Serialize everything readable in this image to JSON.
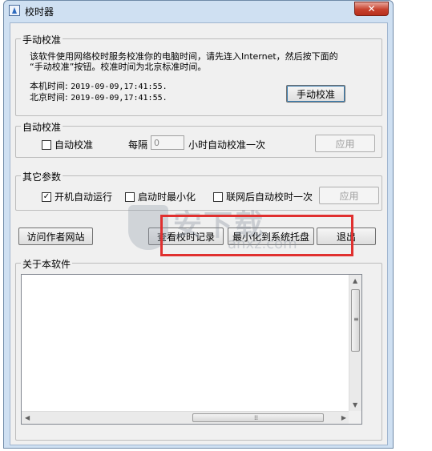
{
  "window": {
    "title": "校时器",
    "close_label": "✕"
  },
  "manual": {
    "legend": "手动校准",
    "description_line1": "该软件使用网络校时服务校准你的电脑时间，请先连入Internet，然后按下面的",
    "description_line2": "“手动校准”按钮。校准时间为北京标准时间。",
    "local_label": "本机时间:",
    "local_value": "2019-09-09,17:41:55.",
    "beijing_label": "北京时间:",
    "beijing_value": "2019-09-09,17:41:55.",
    "button": "手动校准"
  },
  "auto": {
    "legend": "自动校准",
    "checkbox_label": "自动校准",
    "checked": false,
    "every_label": "每隔",
    "interval_value": "0",
    "suffix": "小时自动校准一次",
    "apply_button": "应用"
  },
  "other": {
    "legend": "其它参数",
    "startup_label": "开机自动运行",
    "startup_checked": true,
    "minimize_label": "启动时最小化",
    "minimize_checked": false,
    "network_label": "联网后自动校时一次",
    "network_checked": false,
    "apply_button": "应用"
  },
  "buttons": {
    "visit_site": "访问作者网站",
    "view_log": "查看校时记录",
    "minimize_tray": "最小化到系统托盘",
    "exit": "退出"
  },
  "about": {
    "legend": "关于本软件",
    "content": ""
  },
  "watermark": {
    "text": "安下载",
    "sub": "anxz.com"
  },
  "colors": {
    "highlight_box": "#e0302f",
    "title_bar": "#cfe0f2",
    "close_button": "#c7412d"
  },
  "icons": {
    "app": "clock-app-icon",
    "close": "close-icon"
  }
}
